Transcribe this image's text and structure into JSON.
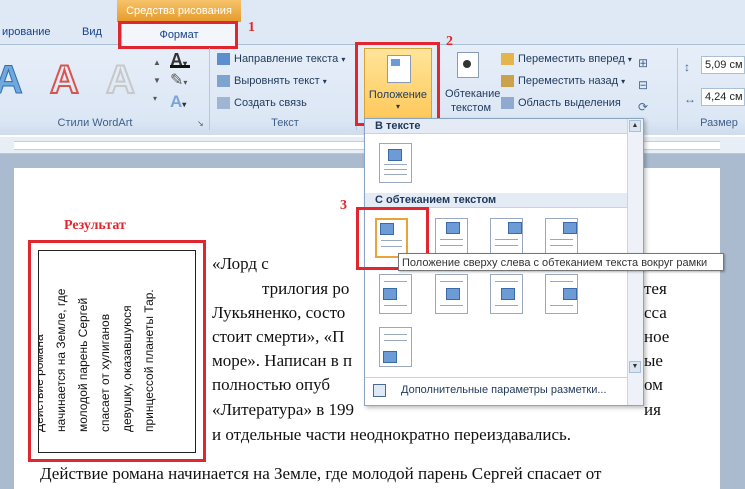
{
  "ribbon": {
    "context_header": "Средства рисования",
    "tabs": [
      {
        "label": "ирование"
      },
      {
        "label": "Вид"
      },
      {
        "label": "Формат"
      }
    ],
    "wordart_group_label": "Стили WordArt",
    "text_group": {
      "label": "Текст",
      "direction": "Направление текста",
      "align": "Выровнять текст",
      "link": "Создать связь"
    },
    "position_button": "Положение",
    "wrap_button_line1": "Обтекание",
    "wrap_button_line2": "текстом",
    "arrange": {
      "forward": "Переместить вперед",
      "backward": "Переместить назад",
      "selection": "Область выделения"
    },
    "size": {
      "height": "5,09 см",
      "width": "4,24 см",
      "label": "Размер"
    }
  },
  "annotations": {
    "n1": "1",
    "n2": "2",
    "n3": "3",
    "result_label": "Результат"
  },
  "rotated_text": {
    "lines": [
      "Действие романа",
      "начинается на Земле, где",
      "молодой парень Сергей",
      "спасает от хулиганов",
      "девушку, оказавшуюся",
      "принцессой планеты Тар."
    ]
  },
  "document": {
    "lines": [
      "«Лорд        с",
      "трилогия ро",
      "Лукьяненко, состо",
      "стоит смерти», «П",
      "море». Написан в п",
      "полностью        опуб",
      "«Литература» в 199",
      "и отдельные части неоднократно переиздавались.",
      "Действие романа начинается на Земле, где молодой парень Сергей спасает от"
    ],
    "right_fragments": [
      "тея",
      "сса",
      "ное",
      "ые",
      "ом",
      "ия"
    ]
  },
  "dropdown": {
    "section_inline": "В тексте",
    "section_wrap": "С обтеканием текстом",
    "more_options": "Дополнительные параметры разметки..."
  },
  "tooltip": "Положение сверху слева с обтеканием текста вокруг рамки",
  "colors": {
    "annotation_red": "#e0262e",
    "context_tab_orange": "#f0b24a",
    "ribbon_blue": "#dfe9f5"
  }
}
